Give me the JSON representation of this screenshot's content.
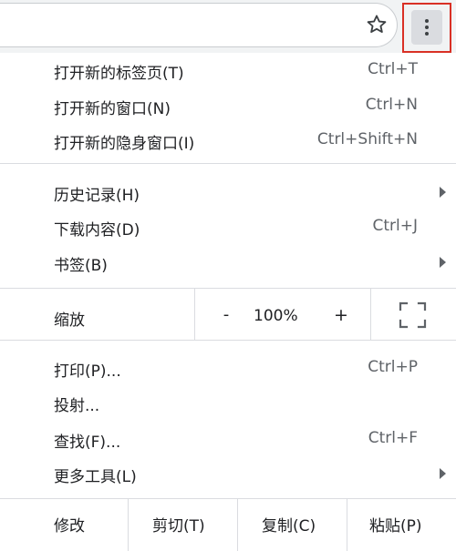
{
  "toolbar": {
    "icons": {
      "star": "star-outline-icon",
      "menu": "kebab-menu-icon"
    },
    "highlight_color": "#d93025"
  },
  "menu": {
    "group1": [
      {
        "label": "打开新的标签页(T)",
        "shortcut": "Ctrl+T"
      },
      {
        "label": "打开新的窗口(N)",
        "shortcut": "Ctrl+N"
      },
      {
        "label": "打开新的隐身窗口(I)",
        "shortcut": "Ctrl+Shift+N"
      }
    ],
    "group2": [
      {
        "label": "历史记录(H)",
        "submenu": true
      },
      {
        "label": "下载内容(D)",
        "shortcut": "Ctrl+J"
      },
      {
        "label": "书签(B)",
        "submenu": true
      }
    ],
    "zoom": {
      "label": "缩放",
      "minus": "-",
      "value": "100%",
      "plus": "+",
      "fullscreen_icon": "fullscreen-icon"
    },
    "group3": [
      {
        "label": "打印(P)...",
        "shortcut": "Ctrl+P"
      },
      {
        "label": "投射..."
      },
      {
        "label": "查找(F)...",
        "shortcut": "Ctrl+F"
      },
      {
        "label": "更多工具(L)",
        "submenu": true
      }
    ],
    "edit": {
      "label": "修改",
      "cut": "剪切(T)",
      "copy": "复制(C)",
      "paste": "粘贴(P)"
    }
  }
}
